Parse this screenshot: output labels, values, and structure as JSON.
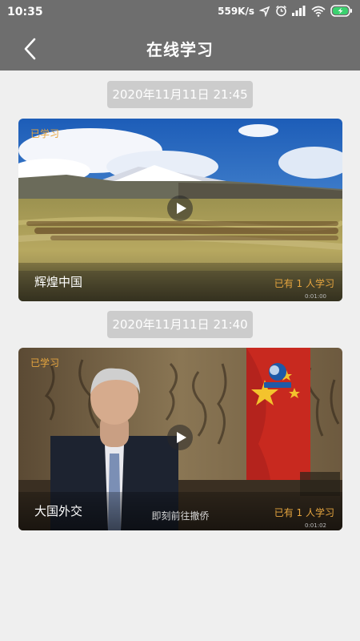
{
  "status_bar": {
    "time": "10:35",
    "network_speed": "559K/s",
    "icons": [
      "location-icon",
      "alarm-icon",
      "signal-icon",
      "wifi-icon",
      "battery-charging-icon"
    ]
  },
  "header": {
    "title": "在线学习",
    "back_icon": "chevron-left-icon"
  },
  "feed": [
    {
      "date": "2020年11月11日 21:45",
      "status_tag": "已学习",
      "title": "辉煌中国",
      "learners": "已有 1 人学习",
      "duration": "0:01:00",
      "play_icon": "play-icon"
    },
    {
      "date": "2020年11月11日 21:40",
      "status_tag": "已学习",
      "title": "大国外交",
      "learners": "已有 1 人学习",
      "duration": "0:01:02",
      "video_subtitle": "即刻前往撤侨",
      "play_icon": "play-icon"
    }
  ],
  "colors": {
    "header_bg": "#6e6e6e",
    "page_bg": "#efefef",
    "date_chip_bg": "#cccccc",
    "accent_orange": "#e6a53f"
  }
}
